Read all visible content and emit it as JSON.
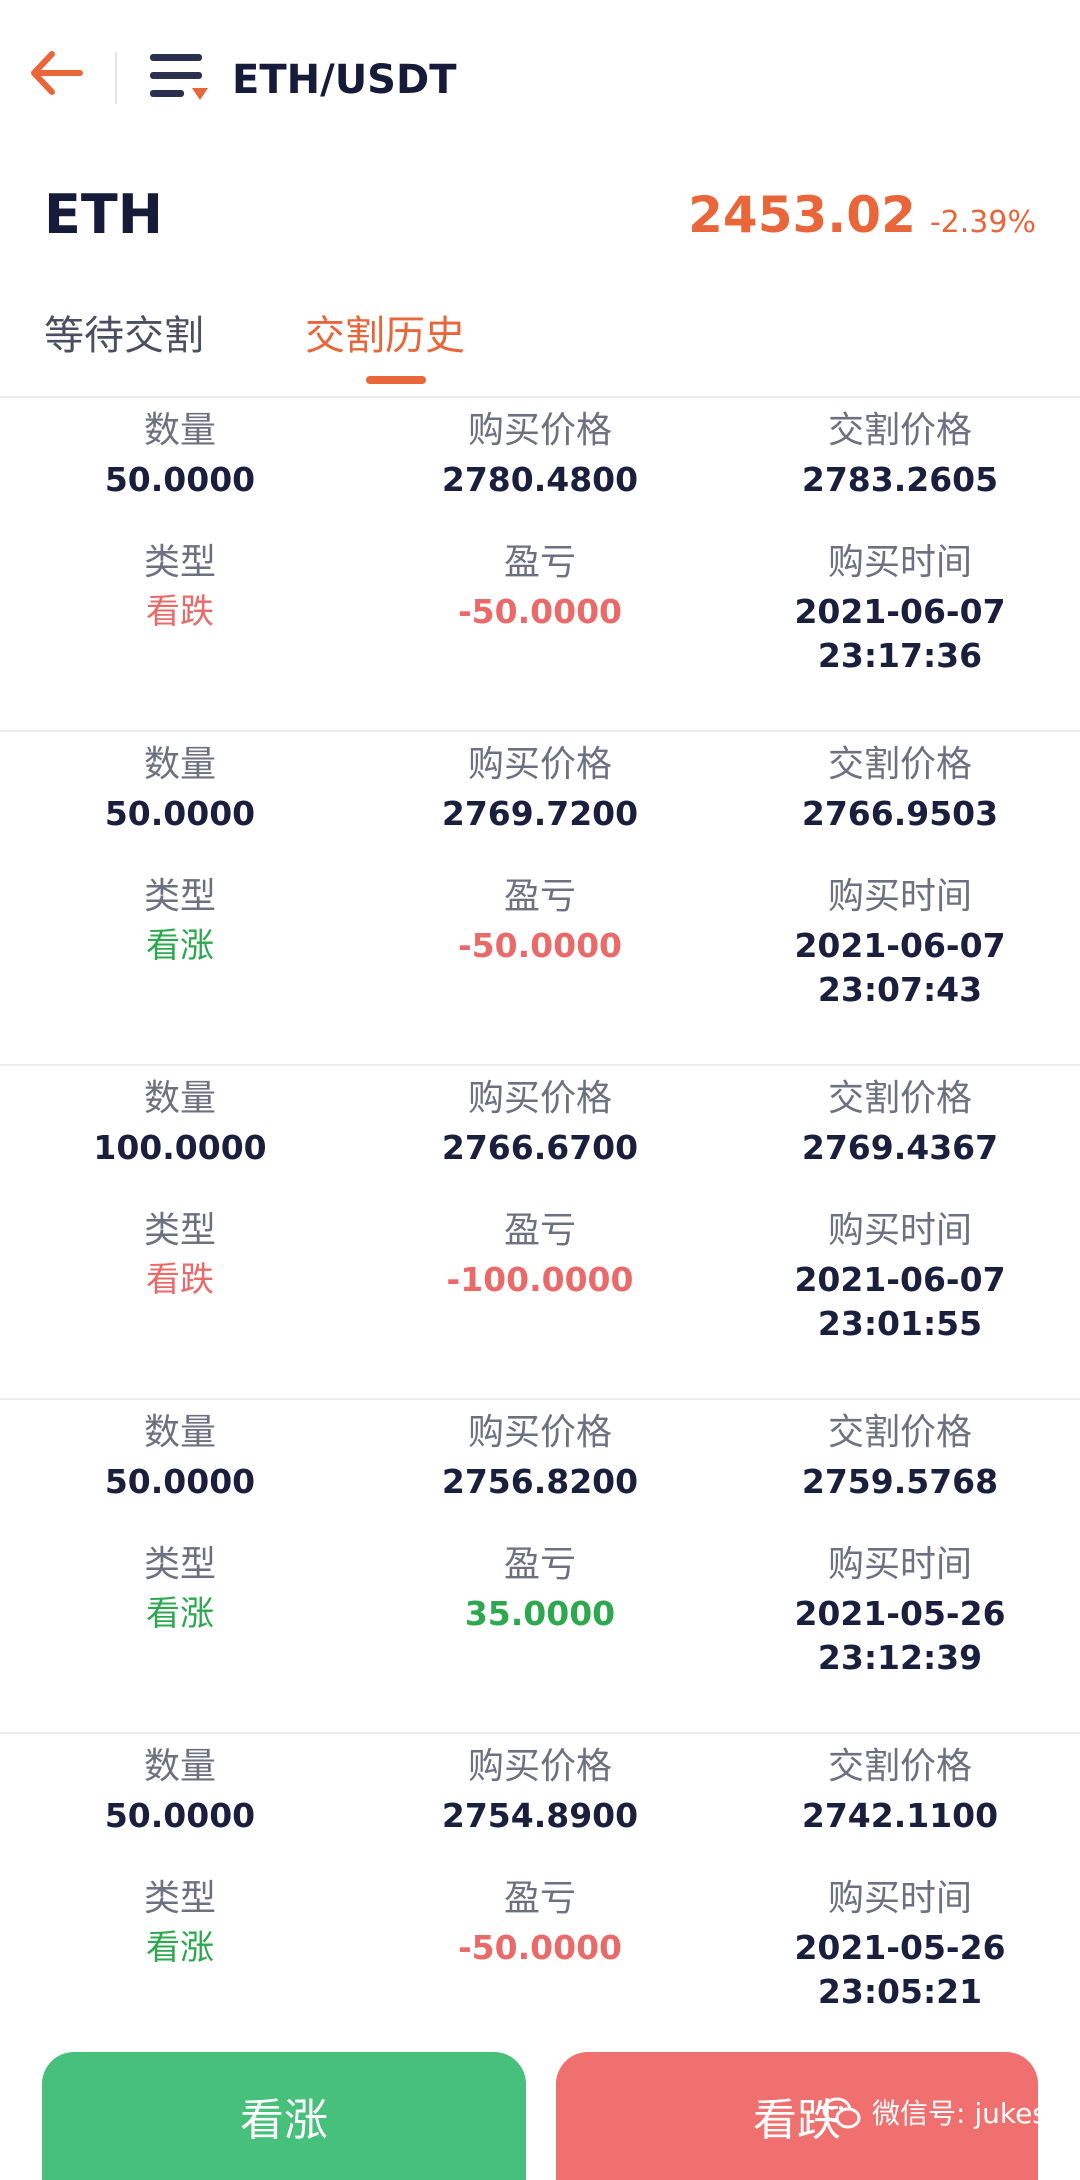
{
  "header": {
    "pair": "ETH/USDT"
  },
  "ticker": {
    "symbol": "ETH",
    "price": "2453.02",
    "change": "-2.39%"
  },
  "tabs": {
    "pending": "等待交割",
    "history": "交割历史"
  },
  "labels": {
    "quantity": "数量",
    "buy_price": "购买价格",
    "settle_price": "交割价格",
    "type": "类型",
    "pnl": "盈亏",
    "buy_time": "购买时间"
  },
  "records": [
    {
      "quantity": "50.0000",
      "buy_price": "2780.4800",
      "settle_price": "2783.2605",
      "type": "看跌",
      "pnl": "-50.0000",
      "buy_date": "2021-06-07",
      "buy_clock": "23:17:36"
    },
    {
      "quantity": "50.0000",
      "buy_price": "2769.7200",
      "settle_price": "2766.9503",
      "type": "看涨",
      "pnl": "-50.0000",
      "buy_date": "2021-06-07",
      "buy_clock": "23:07:43"
    },
    {
      "quantity": "100.0000",
      "buy_price": "2766.6700",
      "settle_price": "2769.4367",
      "type": "看跌",
      "pnl": "-100.0000",
      "buy_date": "2021-06-07",
      "buy_clock": "23:01:55"
    },
    {
      "quantity": "50.0000",
      "buy_price": "2756.8200",
      "settle_price": "2759.5768",
      "type": "看涨",
      "pnl": "35.0000",
      "buy_date": "2021-05-26",
      "buy_clock": "23:12:39"
    },
    {
      "quantity": "50.0000",
      "buy_price": "2754.8900",
      "settle_price": "2742.1100",
      "type": "看涨",
      "pnl": "-50.0000",
      "buy_date": "2021-05-26",
      "buy_clock": "23:05:21"
    }
  ],
  "buttons": {
    "up": "看涨",
    "down": "看跌"
  },
  "watermark": {
    "text": "微信号: jukesu"
  },
  "icons": {
    "back": "arrow-left-icon",
    "menu": "menu-lines-icon",
    "wechat": "wechat-icon"
  },
  "colors": {
    "accent": "#e8663a",
    "up": "#2ea84f",
    "down": "#ea6a6a",
    "button_up": "#46c07a",
    "button_down": "#f07070"
  }
}
